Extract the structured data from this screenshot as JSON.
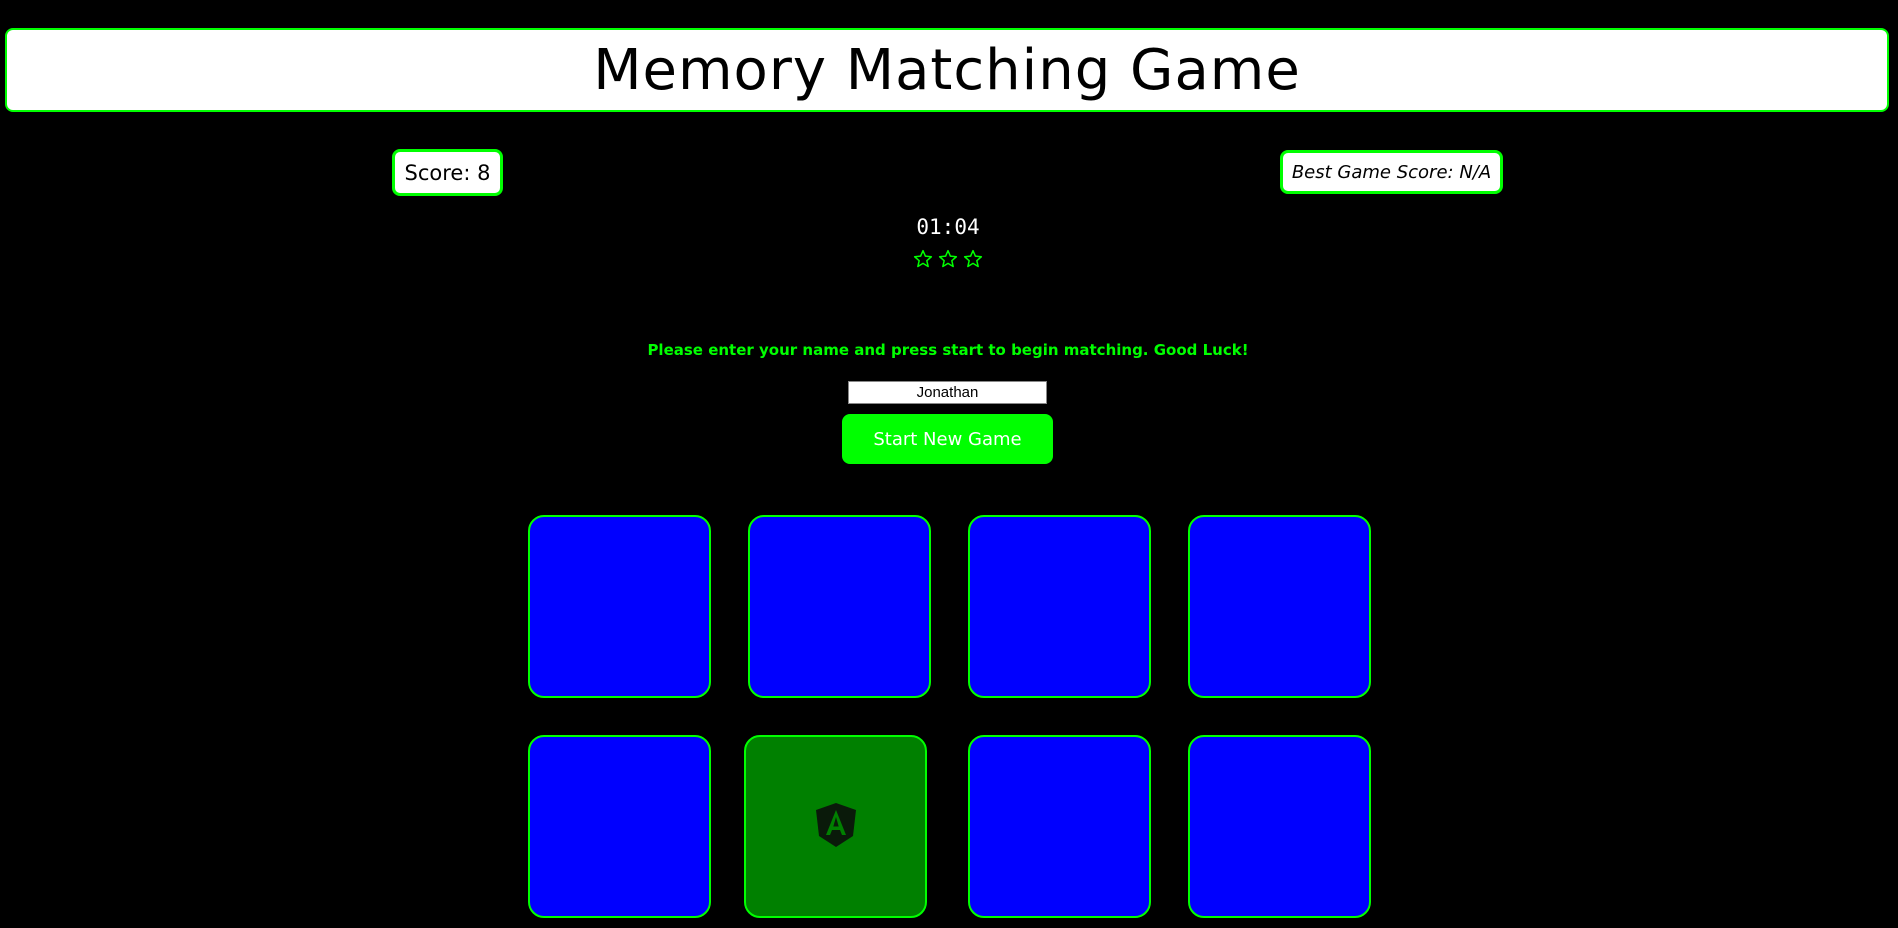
{
  "header": {
    "title": "Memory Matching Game"
  },
  "scoreboard": {
    "score_label": "Score: 8",
    "best_label": "Best Game Score: N/A"
  },
  "timer": {
    "display": "01:04"
  },
  "rating": {
    "stars_total": 3,
    "icon": "star-outline-icon",
    "color": "#00ff00"
  },
  "instructions": "Please enter your name and press start to begin matching. Good Luck!",
  "player": {
    "name_value": "Jonathan"
  },
  "controls": {
    "start_label": "Start New Game"
  },
  "board": {
    "cards": [
      {
        "state": "hidden"
      },
      {
        "state": "hidden"
      },
      {
        "state": "hidden"
      },
      {
        "state": "hidden"
      },
      {
        "state": "hidden"
      },
      {
        "state": "flipped",
        "icon": "angular-logo-icon"
      },
      {
        "state": "hidden"
      },
      {
        "state": "hidden"
      }
    ],
    "hidden_color": "#0000ff",
    "flipped_color": "#008000",
    "border_color": "#00ff00"
  }
}
